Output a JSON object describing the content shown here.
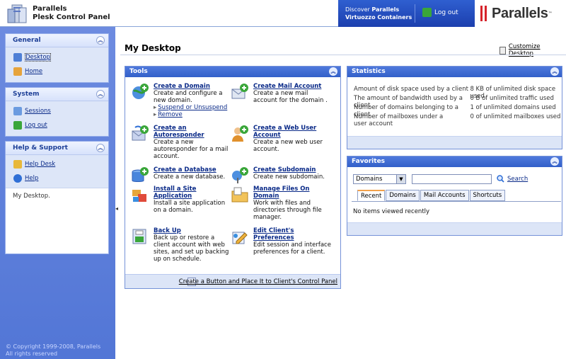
{
  "header": {
    "product_line1": "Parallels",
    "product_line2": "Plesk Control Panel",
    "discover_prefix": "Discover",
    "discover_brand": "Parallels",
    "discover_product": "Virtuozzo Containers",
    "logout_label": "Log out",
    "brand_name": "Parallels",
    "brand_tm": "™"
  },
  "sidebar": {
    "general": {
      "title": "General",
      "items": [
        {
          "label": "Desktop",
          "icon": "desktop-icon"
        },
        {
          "label": "Home",
          "icon": "home-icon"
        }
      ]
    },
    "system": {
      "title": "System",
      "items": [
        {
          "label": "Sessions",
          "icon": "sessions-icon"
        },
        {
          "label": "Log out",
          "icon": "logout-icon"
        }
      ]
    },
    "help": {
      "title": "Help & Support",
      "items": [
        {
          "label": "Help Desk",
          "icon": "helpdesk-icon"
        },
        {
          "label": "Help",
          "icon": "help-icon"
        }
      ],
      "note": "My Desktop."
    },
    "copyright_line1": "© Copyright 1999-2008, Parallels",
    "copyright_line2": "All rights reserved"
  },
  "main": {
    "page_title": "My Desktop",
    "customize_label": "Customize Desktop"
  },
  "tools": {
    "title": "Tools",
    "items": [
      {
        "title": "Create a Domain",
        "desc": "Create and configure a new domain.",
        "sub1": "Suspend or Unsuspend",
        "sub2": "Remove"
      },
      {
        "title": "Create Mail Account",
        "desc": "Create a new mail account for the domain ."
      },
      {
        "title": "Create an Autoresponder",
        "desc": "Create a new autoresponder for a mail account."
      },
      {
        "title": "Create a Web User Account",
        "desc": "Create a new web user account."
      },
      {
        "title": "Create a Database",
        "desc": "Create a new database."
      },
      {
        "title": "Create Subdomain",
        "desc": "Create new subdomain."
      },
      {
        "title": "Install a Site Application",
        "desc": "Install a site application on a domain."
      },
      {
        "title": "Manage Files On Domain",
        "desc": "Work with files and directories through file manager."
      },
      {
        "title": "Back Up",
        "desc": "Back up or restore a client account with web sites, and set up backing up on schedule."
      },
      {
        "title": "Edit Client's Preferences",
        "desc": "Edit session and interface preferences for a client."
      }
    ],
    "footer_link": "Create a Button and Place It to Client's Control Panel"
  },
  "statistics": {
    "title": "Statistics",
    "rows": [
      {
        "k": "Amount of disk space used by a client",
        "v": "8 KB of unlimited disk space used"
      },
      {
        "k": "The amount of bandwidth used by a client",
        "v": "0 B of unlimited traffic used"
      },
      {
        "k": "Number of domains belonging to a client",
        "v": "1 of unlimited domains used"
      },
      {
        "k": "Number of mailboxes under a user account",
        "v": "0 of unlimited mailboxes used"
      }
    ]
  },
  "favorites": {
    "title": "Favorites",
    "select_value": "Domains",
    "search_label": "Search",
    "tabs": [
      "Recent",
      "Domains",
      "Mail Accounts",
      "Shortcuts"
    ],
    "empty_text": "No items viewed recently"
  },
  "colors": {
    "sidebar_bg": "#5e80dc",
    "panel_header": "#3f6bd2",
    "brand_red": "#d6232a"
  }
}
